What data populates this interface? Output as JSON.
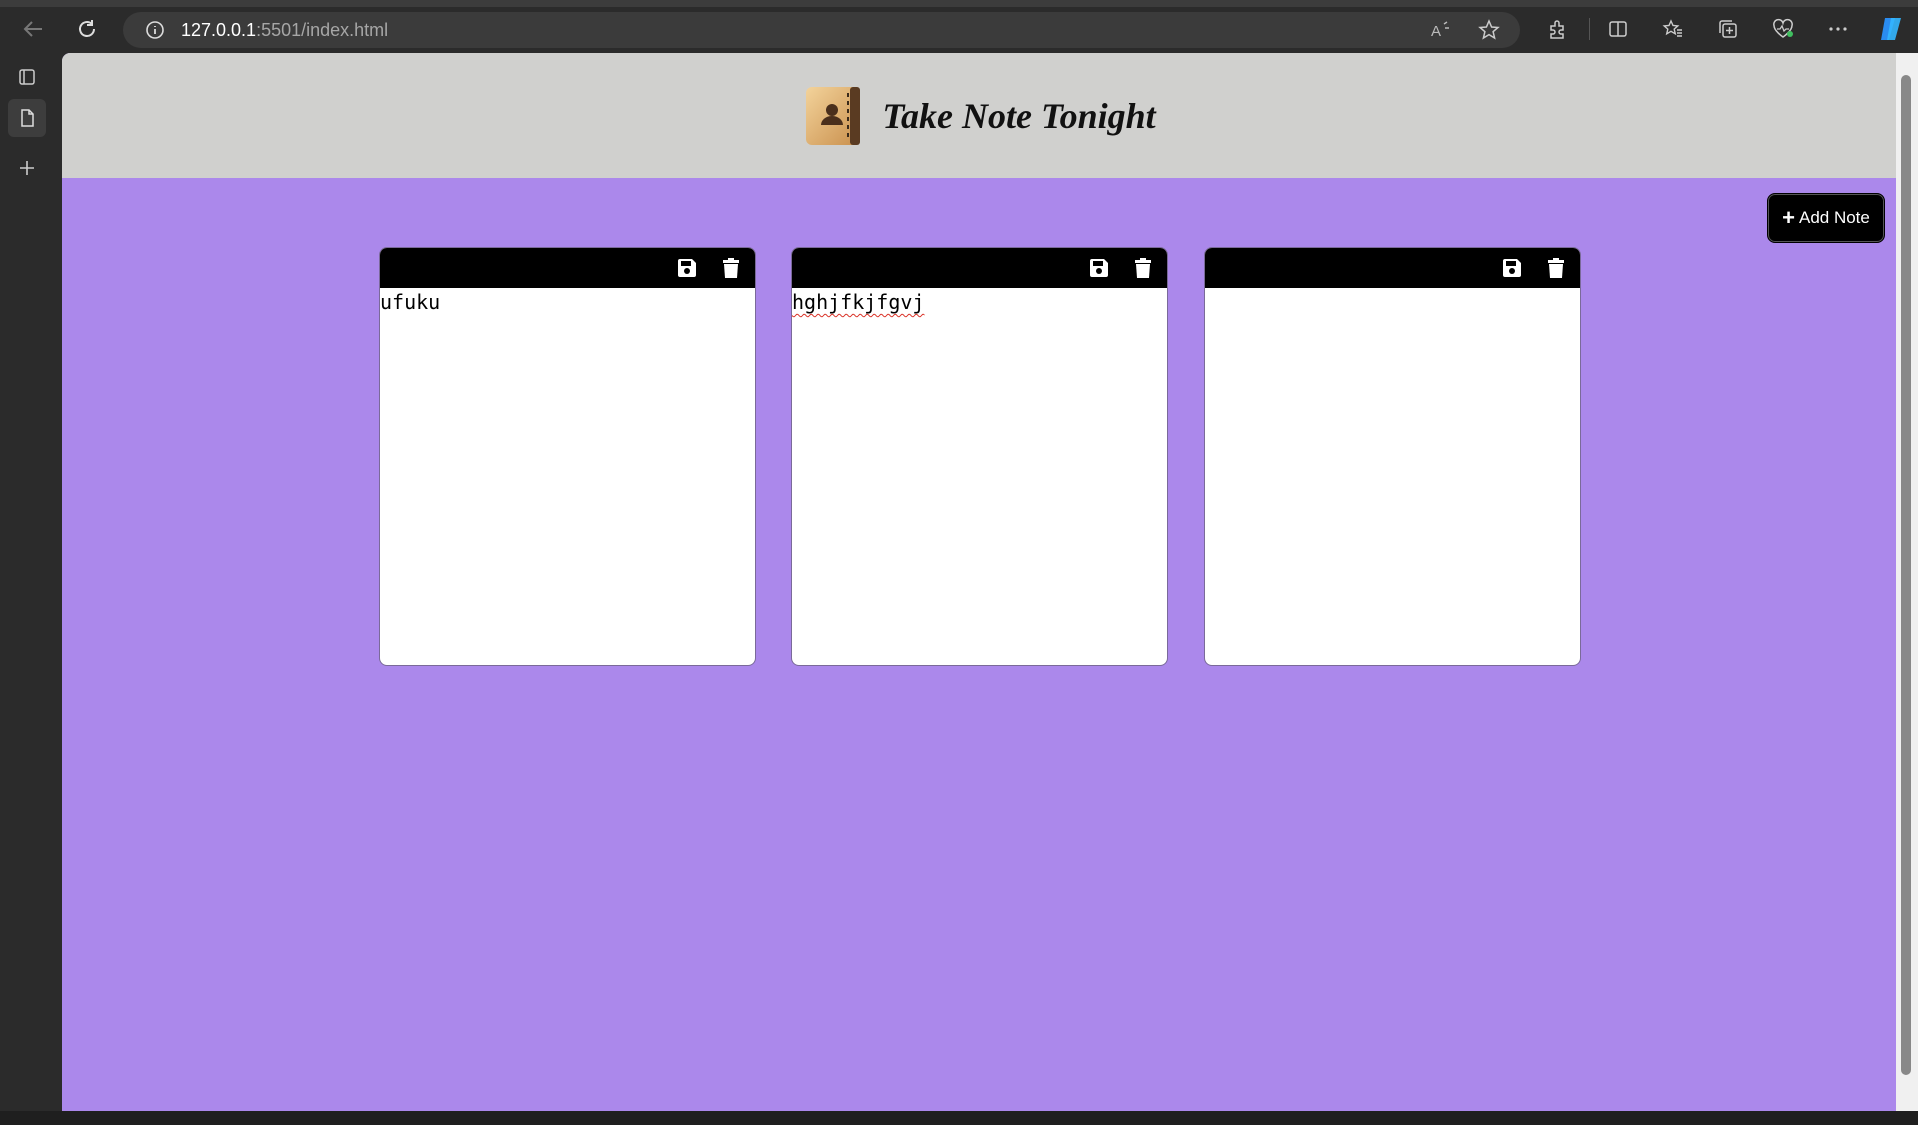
{
  "browser": {
    "url_host": "127.0.0.1",
    "url_path": ":5501/index.html"
  },
  "app": {
    "title": "Take Note Tonight",
    "logo_icon": "address-book-icon",
    "add_button_label": "Add Note",
    "background_color": "#ab88eb",
    "header_color": "#d0d0ce"
  },
  "notes": [
    {
      "text": "ufuku",
      "spellcheck_flag": false
    },
    {
      "text": "hghjfkjfgvj",
      "spellcheck_flag": true
    },
    {
      "text": "",
      "spellcheck_flag": false
    }
  ]
}
